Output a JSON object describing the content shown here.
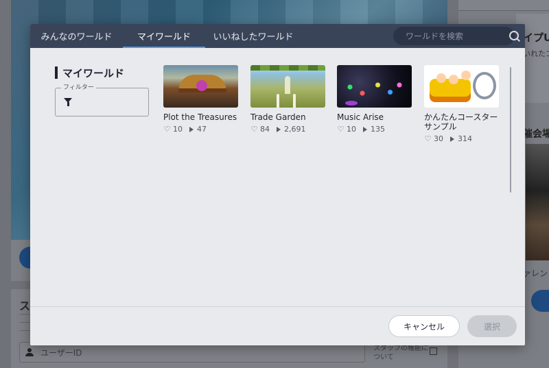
{
  "background": {
    "lower_title": "ス",
    "userid_placeholder": "ユーザーID",
    "staff_note": "スタッフの権能に ついて",
    "right_label1": "イプU",
    "right_label2": "いれたコ",
    "right_label3": "催会場",
    "right_label4": "ァレン"
  },
  "modal": {
    "tabs": [
      {
        "label": "みんなのワールド"
      },
      {
        "label": "マイワールド"
      },
      {
        "label": "いいねしたワールド"
      }
    ],
    "active_tab": 1,
    "search": {
      "placeholder": "ワールドを検索"
    },
    "sidebar": {
      "title": "マイワールド",
      "filter_label": "フィルター"
    },
    "worlds": [
      {
        "title": "Plot the Treasures",
        "likes": "10",
        "plays": "47"
      },
      {
        "title": "Trade Garden",
        "likes": "84",
        "plays": "2,691"
      },
      {
        "title": "Music Arise",
        "likes": "10",
        "plays": "135"
      },
      {
        "title": "かんたんコースターサンプル",
        "likes": "30",
        "plays": "314"
      }
    ],
    "footer": {
      "cancel_label": "キャンセル",
      "select_label": "選択"
    }
  },
  "colors": {
    "header_bg": "#3a4459",
    "active_tab_underline": "#4a9af0",
    "modal_bg": "#e8eaed"
  },
  "icons": [
    "search-icon",
    "filter-icon",
    "heart-icon",
    "play-icon",
    "person-icon",
    "external-link-icon"
  ]
}
